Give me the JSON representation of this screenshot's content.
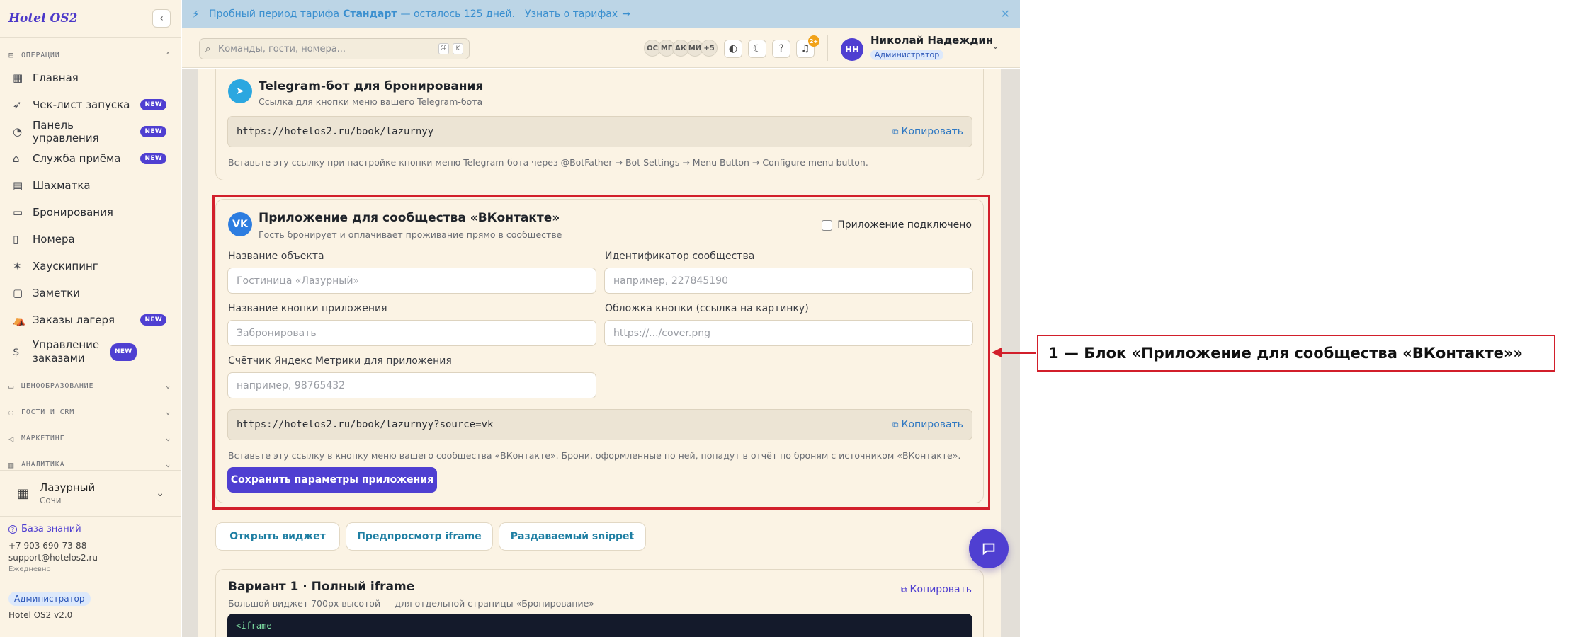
{
  "app": {
    "brand": "Hotel OS2",
    "version": "Hotel OS2 v2.0"
  },
  "sidebar": {
    "group_operations": "ОПЕРАЦИИ",
    "items": [
      {
        "label": "Главная",
        "icon": "dashboard-grid-icon",
        "new": false
      },
      {
        "label": "Чек-лист запуска",
        "icon": "rocket-icon",
        "new": true
      },
      {
        "label": "Панель управления",
        "icon": "gauge-icon",
        "new": true
      },
      {
        "label": "Служба приёма",
        "icon": "bell-desk-icon",
        "new": true
      },
      {
        "label": "Шахматка",
        "icon": "grid-table-icon",
        "new": false
      },
      {
        "label": "Бронирования",
        "icon": "clipboard-icon",
        "new": false
      },
      {
        "label": "Номера",
        "icon": "door-icon",
        "new": false
      },
      {
        "label": "Хаускипинг",
        "icon": "sparkle-icon",
        "new": false
      },
      {
        "label": "Заметки",
        "icon": "note-icon",
        "new": false
      },
      {
        "label": "Заказы лагеря",
        "icon": "tent-icon",
        "new": true
      },
      {
        "label": "Управление заказами",
        "icon": "dollar-doc-icon",
        "new": true
      }
    ],
    "new_badge": "NEW",
    "collapsed_groups": [
      "ЦЕНООБРАЗОВАНИЕ",
      "ГОСТИ И CRM",
      "МАРКЕТИНГ",
      "АНАЛИТИКА"
    ],
    "property": {
      "name": "Лазурный",
      "city": "Сочи"
    },
    "footer": {
      "knowledge_base": "База знаний",
      "phone": "+7 903 690-73-88",
      "email": "support@hotelos2.ru",
      "schedule": "Ежедневно",
      "role": "Администратор"
    }
  },
  "promo": {
    "text_before": "Пробный период тарифа",
    "plan": "Стандарт",
    "text_after": "— осталось 125 дней.",
    "link": "Узнать о тарифах",
    "link_arrow": "→"
  },
  "topbar": {
    "search_placeholder": "Команды, гости, номера...",
    "kbd_1": "⌘",
    "kbd_2": "K",
    "avatars": [
      "ОС",
      "МГ",
      "АК",
      "МИ",
      "+5"
    ],
    "notifications_count": "2+",
    "user_initials": "НН",
    "user_name": "Николай Надеждин",
    "user_role": "Администратор"
  },
  "telegram_card": {
    "title": "Telegram-бот для бронирования",
    "subtitle": "Ссылка для кнопки меню вашего Telegram-бота",
    "url": "https://hotelos2.ru/book/lazurnyy",
    "copy_label": "Копировать",
    "hint": "Вставьте эту ссылку при настройке кнопки меню Telegram-бота через @BotFather → Bot Settings → Menu Button → Configure menu button."
  },
  "vk_card": {
    "badge": "VK",
    "title": "Приложение для сообщества «ВКонтакте»",
    "subtitle": "Гость бронирует и оплачивает проживание прямо в сообществе",
    "connected_label": "Приложение подключено",
    "fields": {
      "object_name_label": "Название объекта",
      "object_name_placeholder": "Гостиница «Лазурный»",
      "community_id_label": "Идентификатор сообщества",
      "community_id_placeholder": "например, 227845190",
      "button_name_label": "Название кнопки приложения",
      "button_name_placeholder": "Забронировать",
      "cover_label": "Обложка кнопки (ссылка на картинку)",
      "cover_placeholder": "https://.../cover.png",
      "metrika_label": "Счётчик Яндекс Метрики для приложения",
      "metrika_placeholder": "например, 98765432"
    },
    "url": "https://hotelos2.ru/book/lazurnyy?source=vk",
    "copy_label": "Копировать",
    "hint": "Вставьте эту ссылку в кнопку меню вашего сообщества «ВКонтакте». Брони, оформленные по ней, попадут в отчёт по броням с источником «ВКонтакте».",
    "save_label": "Сохранить параметры приложения"
  },
  "actions": {
    "open_widget": "Открыть виджет",
    "preview_iframe": "Предпросмотр iframe",
    "shared_snippet": "Раздаваемый snippet"
  },
  "variant_card": {
    "title": "Вариант 1 · Полный iframe",
    "subtitle": "Большой виджет 700px высотой — для отдельной страницы «Бронирование»",
    "copy_label": "Копировать",
    "code": "<iframe"
  },
  "annotation": {
    "label": "1 — Блок «Приложение для сообщества «ВКонтакте»»",
    "color": "#d21f2b"
  },
  "colors": {
    "accent": "#4f3fd1",
    "sidebar_bg": "#fbf3e4",
    "promo_bg": "#bcd5e6",
    "link": "#2f78c2"
  }
}
